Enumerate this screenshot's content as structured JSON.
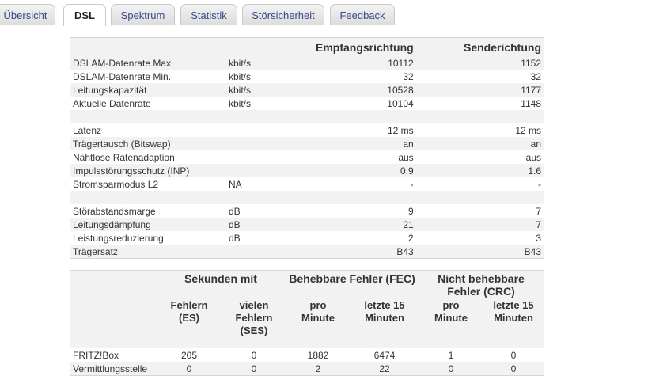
{
  "tabs": [
    {
      "label": "Übersicht",
      "active": false
    },
    {
      "label": "DSL",
      "active": true
    },
    {
      "label": "Spektrum",
      "active": false
    },
    {
      "label": "Statistik",
      "active": false
    },
    {
      "label": "Störsicherheit",
      "active": false
    },
    {
      "label": "Feedback",
      "active": false
    }
  ],
  "dsl_table": {
    "col_headers": {
      "empfang": "Empfangsrichtung",
      "sende": "Senderichtung"
    },
    "rows": [
      {
        "label": "DSLAM-Datenrate Max.",
        "unit": "kbit/s",
        "down": "10112",
        "up": "1152"
      },
      {
        "label": "DSLAM-Datenrate Min.",
        "unit": "kbit/s",
        "down": "32",
        "up": "32"
      },
      {
        "label": "Leitungskapazität",
        "unit": "kbit/s",
        "down": "10528",
        "up": "1177"
      },
      {
        "label": "Aktuelle Datenrate",
        "unit": "kbit/s",
        "down": "10104",
        "up": "1148"
      },
      {
        "label": "",
        "unit": "",
        "down": "",
        "up": ""
      },
      {
        "label": "Latenz",
        "unit": "",
        "down": "12 ms",
        "up": "12 ms"
      },
      {
        "label": "Trägertausch (Bitswap)",
        "unit": "",
        "down": "an",
        "up": "an"
      },
      {
        "label": "Nahtlose Ratenadaption",
        "unit": "",
        "down": "aus",
        "up": "aus"
      },
      {
        "label": "Impulsstörungsschutz (INP)",
        "unit": "",
        "down": "0.9",
        "up": "1.6"
      },
      {
        "label": "Stromsparmodus L2",
        "unit": "NA",
        "down": "-",
        "up": "-"
      },
      {
        "label": "",
        "unit": "",
        "down": "",
        "up": ""
      },
      {
        "label": "Störabstandsmarge",
        "unit": "dB",
        "down": "9",
        "up": "7"
      },
      {
        "label": "Leitungsdämpfung",
        "unit": "dB",
        "down": "21",
        "up": "7"
      },
      {
        "label": "Leistungsreduzierung",
        "unit": "dB",
        "down": "2",
        "up": "3"
      },
      {
        "label": "Trägersatz",
        "unit": "",
        "down": "B43",
        "up": "B43"
      }
    ]
  },
  "error_table": {
    "groups": {
      "sekunden": "Sekunden mit",
      "fec": "Behebbare Fehler (FEC)",
      "crc": "Nicht behebbare Fehler (CRC)"
    },
    "subs": {
      "es": "Fehlern (ES)",
      "ses": "vielen Fehlern (SES)",
      "fec_pro": "pro Minute",
      "fec_15": "letzte 15 Minuten",
      "crc_pro": "pro Minute",
      "crc_15": "letzte 15 Minuten"
    },
    "rows": [
      {
        "label": "FRITZ!Box",
        "es": "205",
        "ses": "0",
        "fec_pro": "1882",
        "fec_15": "6474",
        "crc_pro": "1",
        "crc_15": "0"
      },
      {
        "label": "Vermittlungsstelle",
        "es": "0",
        "ses": "0",
        "fec_pro": "2",
        "fec_15": "22",
        "crc_pro": "0",
        "crc_15": "0"
      }
    ]
  }
}
